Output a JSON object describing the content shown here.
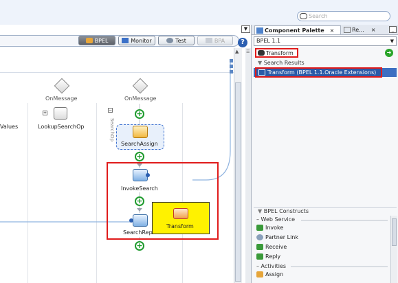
{
  "search": {
    "placeholder": "Search"
  },
  "toolbar": {
    "bpel_label": "BPEL",
    "monitor_label": "Monitor",
    "test_label": "Test",
    "bpa_label": "BPA"
  },
  "canvas": {
    "branch1_label": "OnMessage",
    "branch2_label": "OnMessage",
    "left_values_label": "Values",
    "lookup_label": "LookupSearchOp",
    "scope_vertical_label": "SearchOp",
    "searchassign_label": "SearchAssign",
    "invokesearch_label": "InvokeSearch",
    "searchreply_label": "SearchRep",
    "transform_drag_label": "Transform"
  },
  "palette": {
    "tab_component": "Component Palette",
    "tab_re": "Re...",
    "selected_library": "BPEL 1.1",
    "search_value": "Transform",
    "results_header": "Search Results",
    "result_item": "Transform (BPEL 1.1.Oracle Extensions)",
    "constructs_header": "BPEL Constructs",
    "groups": {
      "web_service": "Web Service",
      "activities": "Activities"
    },
    "items": {
      "invoke": "Invoke",
      "partner_link": "Partner Link",
      "receive": "Receive",
      "reply": "Reply",
      "assign": "Assign"
    }
  },
  "colors": {
    "highlight_red": "#e01b1b",
    "selection_blue": "#2a5aa8",
    "drag_yellow": "#fff200",
    "plus_green": "#1f9b2e"
  }
}
